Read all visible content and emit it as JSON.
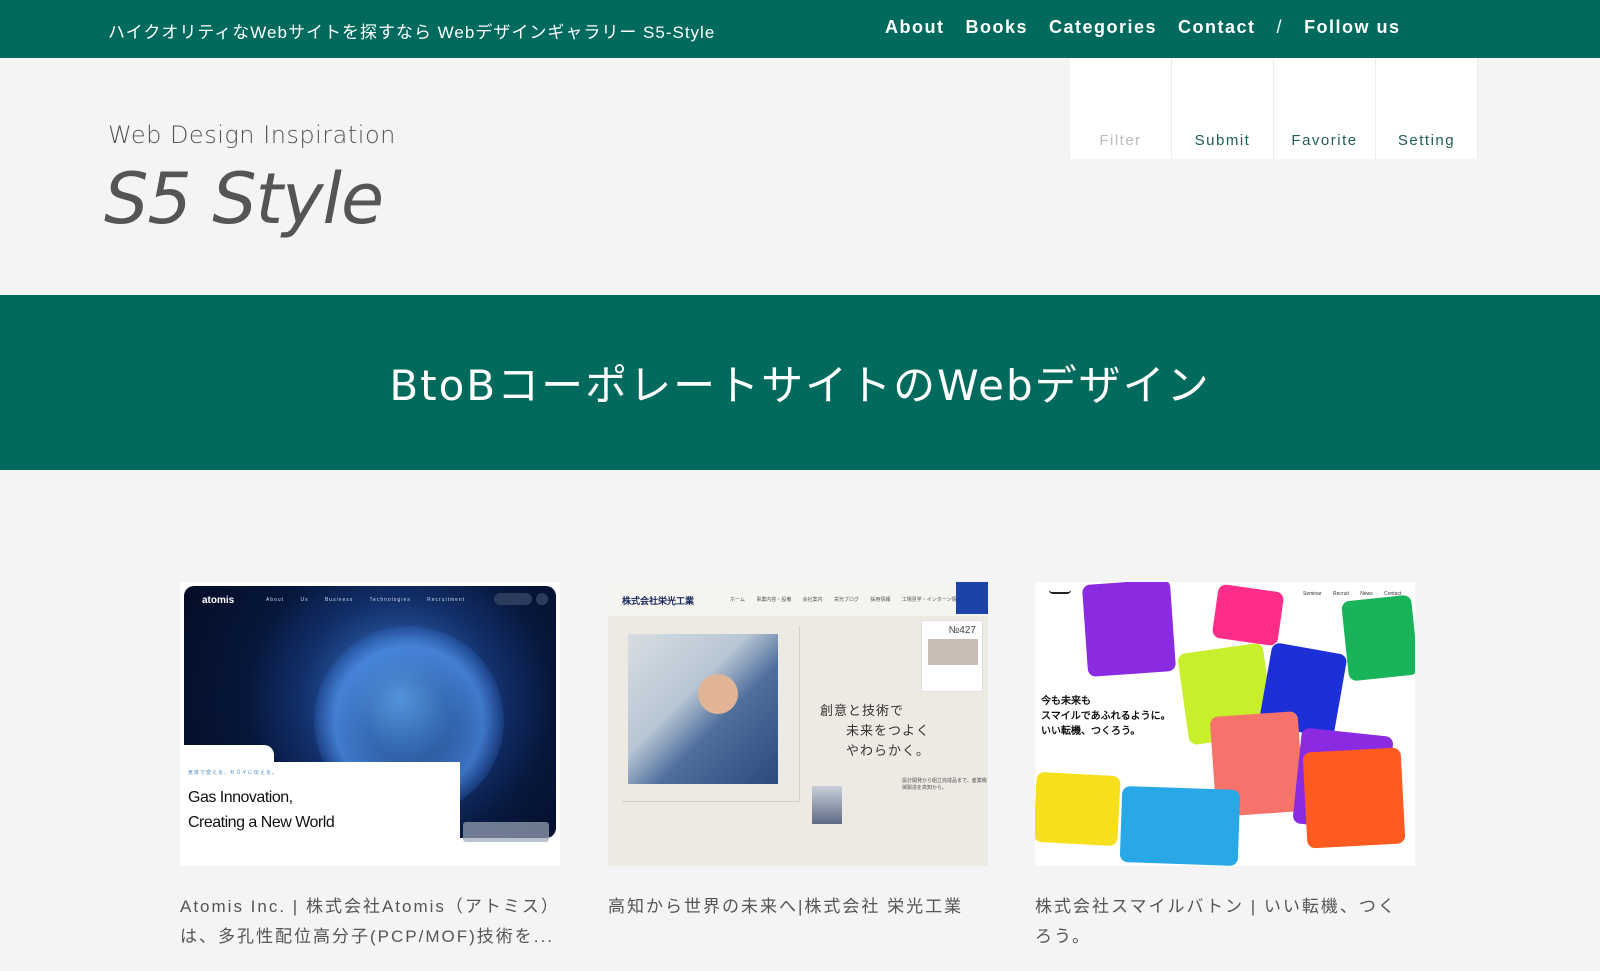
{
  "topbar": {
    "tagline": "ハイクオリティなWebサイトを探すなら Webデザインギャラリー S5-Style",
    "nav": [
      "About",
      "Books",
      "Categories",
      "Contact"
    ],
    "separator": "/",
    "follow": "Follow us"
  },
  "header": {
    "logo_sub": "Web Design Inspiration",
    "logo_main": "S5 Style",
    "util": [
      {
        "label": "Filter",
        "enabled": false
      },
      {
        "label": "Submit",
        "enabled": true
      },
      {
        "label": "Favorite",
        "enabled": true
      },
      {
        "label": "Setting",
        "enabled": true
      }
    ]
  },
  "banner": {
    "title": "BtoBコーポレートサイトのWebデザイン"
  },
  "cards": [
    {
      "caption": "Atomis Inc. | 株式会社Atomis（アトミス）は、多孔性配位高分子(PCP/MOF)技術を...",
      "thumb": {
        "logo": "atomis",
        "nav": "About Us Business Technologies Recruitment",
        "tagline": "気体で変える、セカイに伝える。",
        "headline_1": "Gas Innovation,",
        "headline_2": "Creating a New World"
      }
    },
    {
      "caption": "高知から世界の未来へ|株式会社 栄光工業",
      "thumb": {
        "brand": "株式会社栄光工業",
        "nav": "ホーム 事業内容・設備 会社案内 栄光ブログ 採用情報 工場見学・インターン情報",
        "copy_1": "創意と技術で",
        "copy_2": "未来をつよく",
        "copy_3": "やわらかく。",
        "number": "№427",
        "small_text": "設計開発から組立完成品まで、産業機械製造を高知から。"
      }
    },
    {
      "caption": "株式会社スマイルバトン | いい転機、つくろう。",
      "thumb": {
        "nav": "Seminar Recruit News Contact",
        "copy_1": "今も未来も",
        "copy_2": "スマイルであふれるように。",
        "copy_3": "いい転機、つくろう。"
      }
    }
  ],
  "colors": {
    "brand_green": "#006a5d",
    "background": "#f4f4f4"
  }
}
